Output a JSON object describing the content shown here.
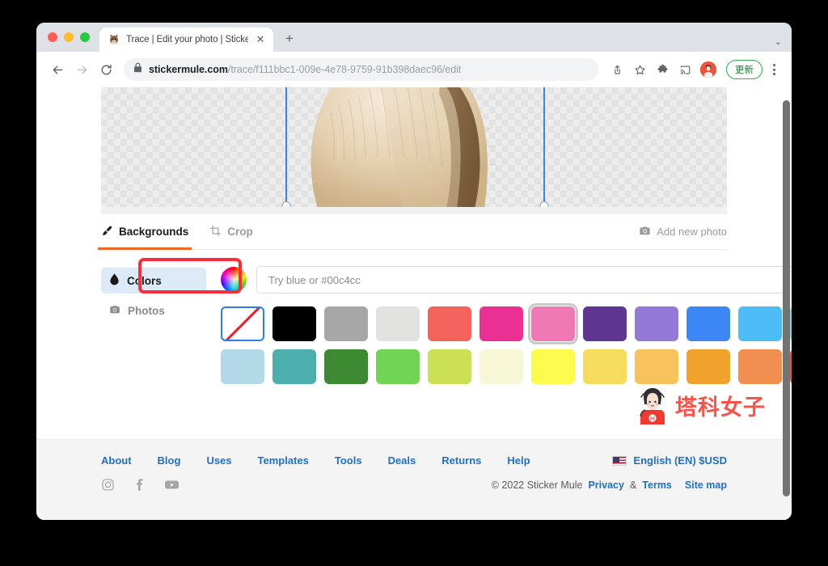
{
  "browser": {
    "tab": {
      "title": "Trace | Edit your photo | Sticker Mule",
      "favicon": "mule-favicon",
      "close_label": "✕"
    },
    "new_tab_label": "+",
    "tabstrip_chevron": "⌄",
    "toolbar": {
      "back_label": "←",
      "forward_label": "→",
      "reload_label": "↻",
      "url_domain": "stickermule.com",
      "url_path": "/trace/f111bbc1-009e-4e78-9759-91b398daec96/edit",
      "share_icon": "share-icon",
      "bookmark_icon": "star-icon",
      "extensions_icon": "puzzle-icon",
      "cast_icon": "cast-icon",
      "profile_icon": "avatar-icon",
      "update_button_label": "更新",
      "menu_icon": "three-dot-menu-icon"
    }
  },
  "editor": {
    "canvas": {
      "subject": "dog-photo",
      "background": "transparent-checkerboard",
      "crop_guides": 2
    },
    "tabs": [
      {
        "label": "Backgrounds",
        "icon": "brush-icon",
        "active": true
      },
      {
        "label": "Crop",
        "icon": "crop-icon",
        "active": false
      }
    ],
    "add_new_photo": {
      "label": "Add new photo",
      "icon": "camera-icon"
    },
    "side_items": [
      {
        "label": "Colors",
        "icon": "droplet-icon",
        "active": true
      },
      {
        "label": "Photos",
        "icon": "camera-icon",
        "active": false
      }
    ],
    "color_wheel_icon": "color-wheel-icon",
    "color_input_placeholder": "Try blue or #00c4cc",
    "color_input_value": "",
    "swatch_rows": [
      [
        {
          "name": "transparent",
          "color": "transparent",
          "transparent": true,
          "selected": false
        },
        {
          "name": "black",
          "color": "#000000",
          "selected": false
        },
        {
          "name": "gray",
          "color": "#a7a7a7",
          "selected": false
        },
        {
          "name": "light-gray",
          "color": "#e2e2e0",
          "selected": false
        },
        {
          "name": "coral-red",
          "color": "#f2635b",
          "selected": false
        },
        {
          "name": "magenta",
          "color": "#ea3193",
          "selected": false
        },
        {
          "name": "pink",
          "color": "#f078b4",
          "selected": true
        },
        {
          "name": "deep-purple",
          "color": "#5e3590",
          "selected": false
        },
        {
          "name": "light-purple",
          "color": "#9378d8",
          "selected": false
        },
        {
          "name": "blue",
          "color": "#3d86f5",
          "selected": false
        },
        {
          "name": "sky-blue",
          "color": "#4ebcf5",
          "selected": false
        },
        {
          "name": "turquoise",
          "color": "#68e2e0",
          "selected": false
        }
      ],
      [
        {
          "name": "pale-blue",
          "color": "#b3d8e8",
          "selected": false
        },
        {
          "name": "teal",
          "color": "#4cafae",
          "selected": false
        },
        {
          "name": "dark-green",
          "color": "#3d8a32",
          "selected": false
        },
        {
          "name": "light-green",
          "color": "#72d454",
          "selected": false
        },
        {
          "name": "yellow-green",
          "color": "#cbe055",
          "selected": false
        },
        {
          "name": "cream",
          "color": "#f7f7d8",
          "selected": false
        },
        {
          "name": "bright-yellow",
          "color": "#fcfb4d",
          "selected": false
        },
        {
          "name": "pale-yellow",
          "color": "#f6dc5c",
          "selected": false
        },
        {
          "name": "light-orange",
          "color": "#f8c25d",
          "selected": false
        },
        {
          "name": "orange",
          "color": "#efa32c",
          "selected": false
        },
        {
          "name": "peach-orange",
          "color": "#f08f4f",
          "selected": false
        },
        {
          "name": "red-orange",
          "color": "#ec5424",
          "selected": false
        }
      ]
    ],
    "highlight_annotation": {
      "target": "Colors",
      "color": "#fc2c3b"
    }
  },
  "watermark": {
    "text": "塔科女子",
    "color": "#f2554b"
  },
  "footer": {
    "links": [
      "About",
      "Blog",
      "Uses",
      "Templates",
      "Tools",
      "Deals",
      "Returns",
      "Help"
    ],
    "language": {
      "label": "English (EN) $USD",
      "flag": "us-flag-icon"
    },
    "social": [
      {
        "name": "instagram-icon"
      },
      {
        "name": "facebook-icon"
      },
      {
        "name": "youtube-icon"
      }
    ],
    "copyright": "© 2022 Sticker Mule",
    "privacy": "Privacy",
    "amp": "&",
    "terms": "Terms",
    "site_map": "Site map"
  },
  "scrollbar": {
    "present": true
  }
}
